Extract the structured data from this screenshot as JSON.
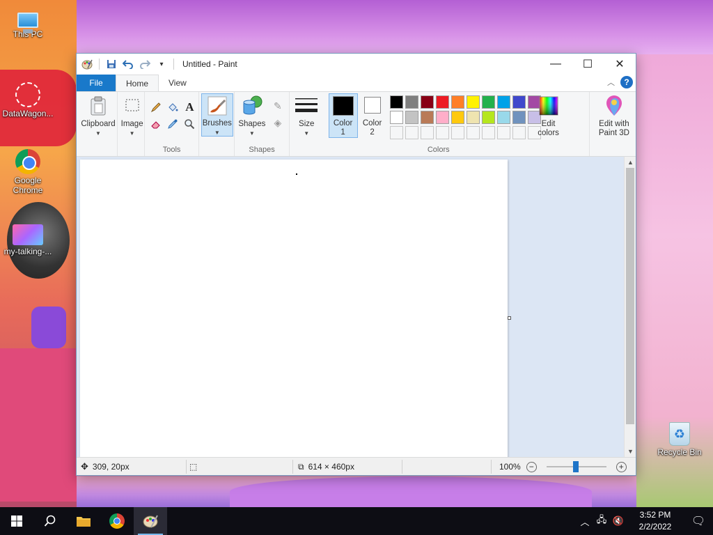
{
  "desktop": {
    "icons": [
      {
        "label": "This PC"
      },
      {
        "label": "DataWagon..."
      },
      {
        "label": "Google Chrome"
      },
      {
        "label": "my-talking-..."
      },
      {
        "label": "Recycle Bin"
      }
    ]
  },
  "window": {
    "title": "Untitled - Paint",
    "controls": {
      "minimize": "—",
      "maximize": "☐",
      "close": "✕"
    }
  },
  "tabs": {
    "file": "File",
    "home": "Home",
    "view": "View",
    "help": "?"
  },
  "ribbon": {
    "clipboard": "Clipboard",
    "image": "Image",
    "tools_label": "Tools",
    "brushes": "Brushes",
    "shapes_btn": "Shapes",
    "shapes_label": "Shapes",
    "size": "Size",
    "color1_line1": "Color",
    "color1_line2": "1",
    "color2_line1": "Color",
    "color2_line2": "2",
    "edit_colors_line1": "Edit",
    "edit_colors_line2": "colors",
    "paint3d_line1": "Edit with",
    "paint3d_line2": "Paint 3D",
    "colors_label": "Colors",
    "color1_value": "#000000",
    "color2_value": "#ffffff",
    "palette_row1": [
      "#000000",
      "#7f7f7f",
      "#880015",
      "#ed1c24",
      "#ff7f27",
      "#fff200",
      "#22b14c",
      "#00a2e8",
      "#3f48cc",
      "#a349a4"
    ],
    "palette_row2": [
      "#ffffff",
      "#c3c3c3",
      "#b97a57",
      "#ffaec9",
      "#ffc90e",
      "#efe4b0",
      "#b5e61d",
      "#99d9ea",
      "#7092be",
      "#c8bfe7"
    ]
  },
  "status": {
    "cursor_pos": "309, 20px",
    "canvas_size": "614 × 460px",
    "zoom": "100%"
  },
  "taskbar": {
    "time": "3:52 PM",
    "date": "2/2/2022"
  }
}
